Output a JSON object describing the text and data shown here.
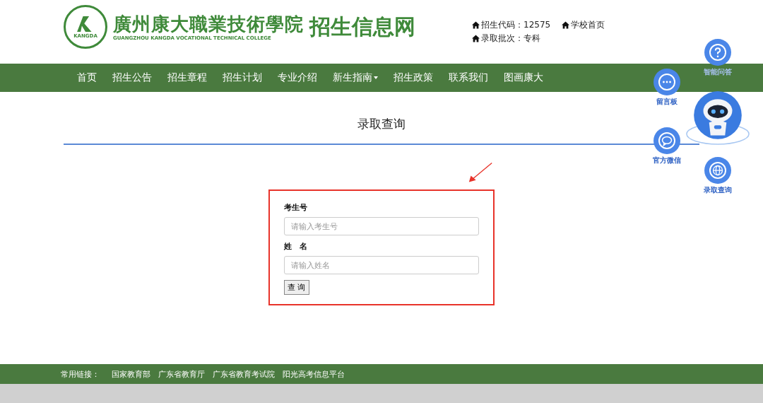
{
  "header": {
    "logo_mark": "KANGDA",
    "college_name": "廣州康大職業技術學院",
    "college_name_en": "GUANGZHOU KANGDA VOCATIONAL TECHNICAL COLLEGE",
    "site_title": "招生信息网",
    "info_links": [
      {
        "text": "招生代码：12575"
      },
      {
        "text": "学校首页"
      },
      {
        "text": "录取批次：专科"
      }
    ]
  },
  "nav": {
    "items": [
      {
        "label": "首页",
        "dropdown": false
      },
      {
        "label": "招生公告",
        "dropdown": false
      },
      {
        "label": "招生章程",
        "dropdown": false
      },
      {
        "label": "招生计划",
        "dropdown": false
      },
      {
        "label": "专业介绍",
        "dropdown": false
      },
      {
        "label": "新生指南",
        "dropdown": true
      },
      {
        "label": "招生政策",
        "dropdown": false
      },
      {
        "label": "联系我们",
        "dropdown": false
      },
      {
        "label": "图画康大",
        "dropdown": false
      }
    ]
  },
  "page_title": "录取查询",
  "form": {
    "fields": [
      {
        "label": "考生号",
        "placeholder": "请输入考生号"
      },
      {
        "label": "姓　名",
        "placeholder": "请输入姓名"
      }
    ],
    "submit": "查 询"
  },
  "float_widgets": [
    {
      "kind": "question",
      "label": "智能问答"
    },
    {
      "kind": "chat",
      "label": "留言板"
    },
    {
      "kind": "robot"
    },
    {
      "kind": "wechat",
      "label": "官方微信"
    },
    {
      "kind": "globe",
      "label": "录取查询"
    }
  ],
  "footer": {
    "heading": "常用链接：",
    "links": [
      "国家教育部",
      "广东省教育厅",
      "广东省教育考试院",
      "阳光高考信息平台"
    ]
  }
}
